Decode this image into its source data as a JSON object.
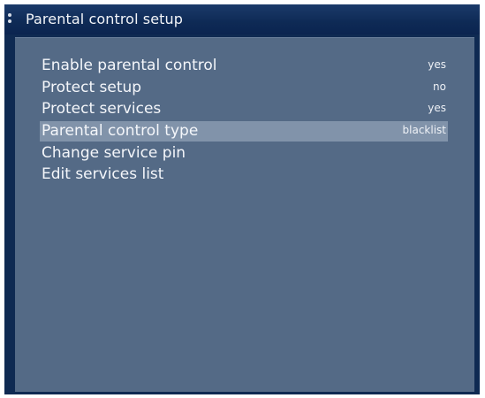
{
  "window": {
    "title": "Parental control setup"
  },
  "menu": {
    "items": [
      {
        "label": "Enable parental control",
        "value": "yes"
      },
      {
        "label": "Protect setup",
        "value": "no"
      },
      {
        "label": "Protect services",
        "value": "yes"
      },
      {
        "label": "Parental control type",
        "value": "blacklist",
        "selected": true
      },
      {
        "label": "Change service pin",
        "value": ""
      },
      {
        "label": "Edit services list",
        "value": ""
      }
    ]
  },
  "colors": {
    "frame": "#0f2a52",
    "panel": "#546a86",
    "highlight": "#8193aa",
    "text": "#f4f6fa"
  }
}
